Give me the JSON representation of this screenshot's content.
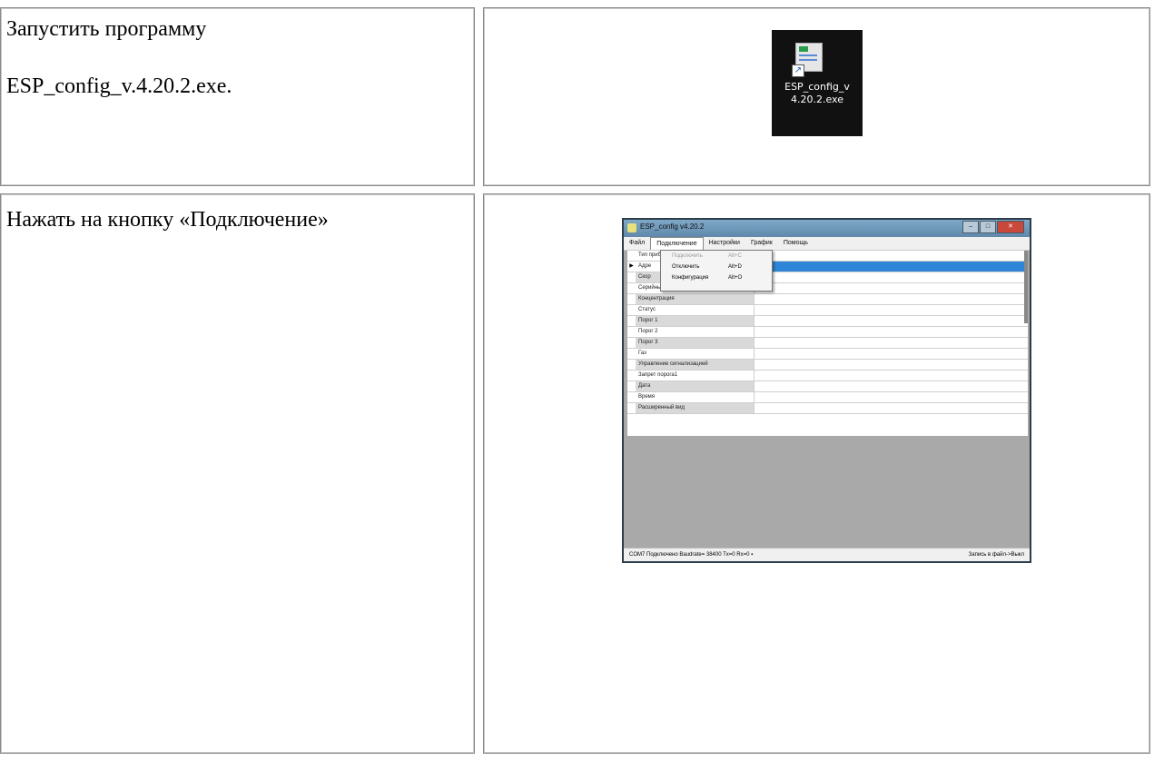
{
  "rows": [
    {
      "instruction_lines": [
        "Запустить программу",
        "ESP_config_v.4.20.2.exe."
      ],
      "shortcut": {
        "icon": "application-shortcut-icon",
        "label": "ESP_config_v\n4.20.2.exe"
      }
    },
    {
      "instruction": "Нажать на кнопку «Подключение»",
      "window": {
        "title": "ESP_config v4.20.2",
        "window_buttons": [
          "minimize-icon",
          "maximize-icon",
          "close-icon"
        ],
        "menu": [
          "Файл",
          "Подключение",
          "Настройки",
          "График",
          "Помощь"
        ],
        "dropdown": [
          {
            "label": "Подключить",
            "shortcut": "Alt+C",
            "disabled": true
          },
          {
            "label": "Отключить",
            "shortcut": "Alt+D",
            "disabled": false
          },
          {
            "label": "Конфигурация",
            "shortcut": "Alt+O",
            "disabled": false
          }
        ],
        "grid_rows": [
          "Тип приб",
          "Адре",
          "Скор",
          "Серийный номер",
          "Концентрация",
          "Статус",
          "Порог 1",
          "Порог 2",
          "Порог 3",
          "Газ",
          "Управление сигнализацией",
          "Запрет порога1",
          "Дата",
          "Время",
          "Расширенный вид"
        ],
        "status_left": "COM7 Подключено Baudrate= 38400 Tx=0 Rx=0  ▪",
        "status_right": "Запись в файл->Выкл"
      }
    }
  ],
  "colors": {
    "border": "#8a8a8a",
    "selection": "#2f86d8",
    "window_bg": "#a9a9a9"
  }
}
